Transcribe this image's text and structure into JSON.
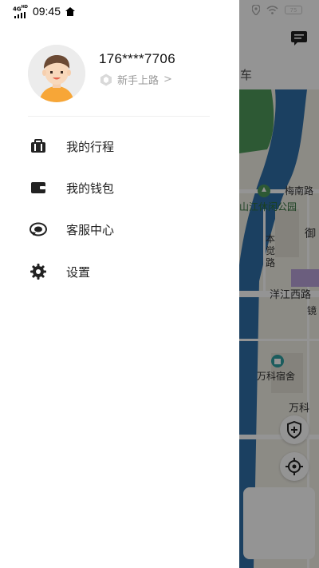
{
  "status_bar": {
    "network": "4G",
    "network_sub": "HD",
    "time": "09:45",
    "battery": "75"
  },
  "profile": {
    "phone": "176****7706",
    "level": "新手上路",
    "level_chevron": ">"
  },
  "menu": {
    "items": [
      {
        "label": "我的行程",
        "icon": "suitcase-icon"
      },
      {
        "label": "我的钱包",
        "icon": "wallet-icon"
      },
      {
        "label": "客服中心",
        "icon": "customer-service-icon"
      },
      {
        "label": "设置",
        "icon": "gear-icon"
      }
    ]
  },
  "map": {
    "tab_text": "车",
    "labels": {
      "meinan_road": "梅南路",
      "park": "山江休闲公园",
      "yu": "御",
      "benjue_road": "本\n觉\n路",
      "yangjiang_west_road": "洋江西路",
      "jing": "镜",
      "vanke_dorm": "万科宿舍",
      "vanke": "万科"
    }
  },
  "colors": {
    "accent": "#000000",
    "river": "#2f6fa8",
    "park_green": "#4e9a5a",
    "avatar_shirt": "#f7a637"
  }
}
